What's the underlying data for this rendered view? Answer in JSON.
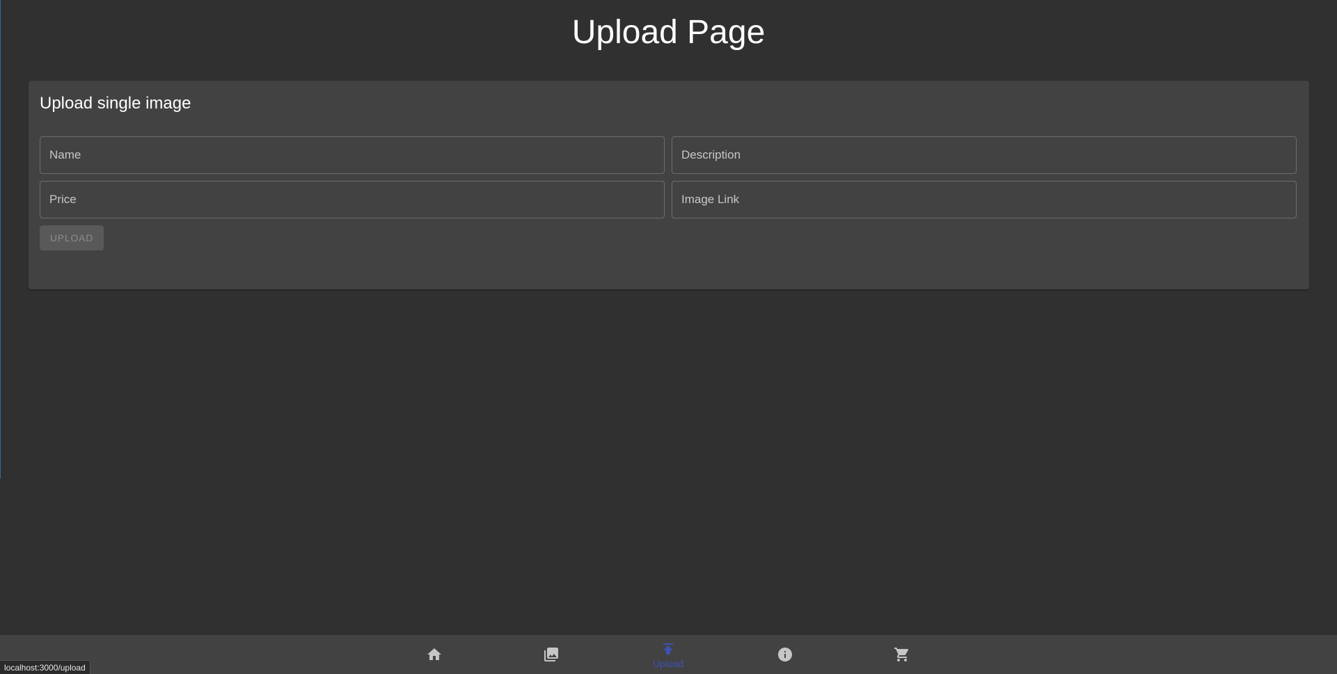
{
  "page": {
    "title": "Upload Page"
  },
  "card": {
    "title": "Upload single image",
    "fields": {
      "name": {
        "placeholder": "Name",
        "value": ""
      },
      "description": {
        "placeholder": "Description",
        "value": ""
      },
      "price": {
        "placeholder": "Price",
        "value": ""
      },
      "image_link": {
        "placeholder": "Image Link",
        "value": ""
      }
    },
    "upload_label": "UPLOAD",
    "upload_disabled": true
  },
  "nav": {
    "items": [
      {
        "id": "home",
        "icon": "home-icon",
        "label": ""
      },
      {
        "id": "gallery",
        "icon": "photo-library-icon",
        "label": ""
      },
      {
        "id": "upload",
        "icon": "upload-icon",
        "label": "Upload",
        "active": true
      },
      {
        "id": "info",
        "icon": "info-icon",
        "label": ""
      },
      {
        "id": "cart",
        "icon": "shopping-cart-icon",
        "label": ""
      }
    ],
    "active_color": "#3f51b5"
  },
  "status": {
    "url": "localhost:3000/upload"
  },
  "colors": {
    "background": "#303030",
    "surface": "#424242",
    "accent": "#3f51b5"
  }
}
